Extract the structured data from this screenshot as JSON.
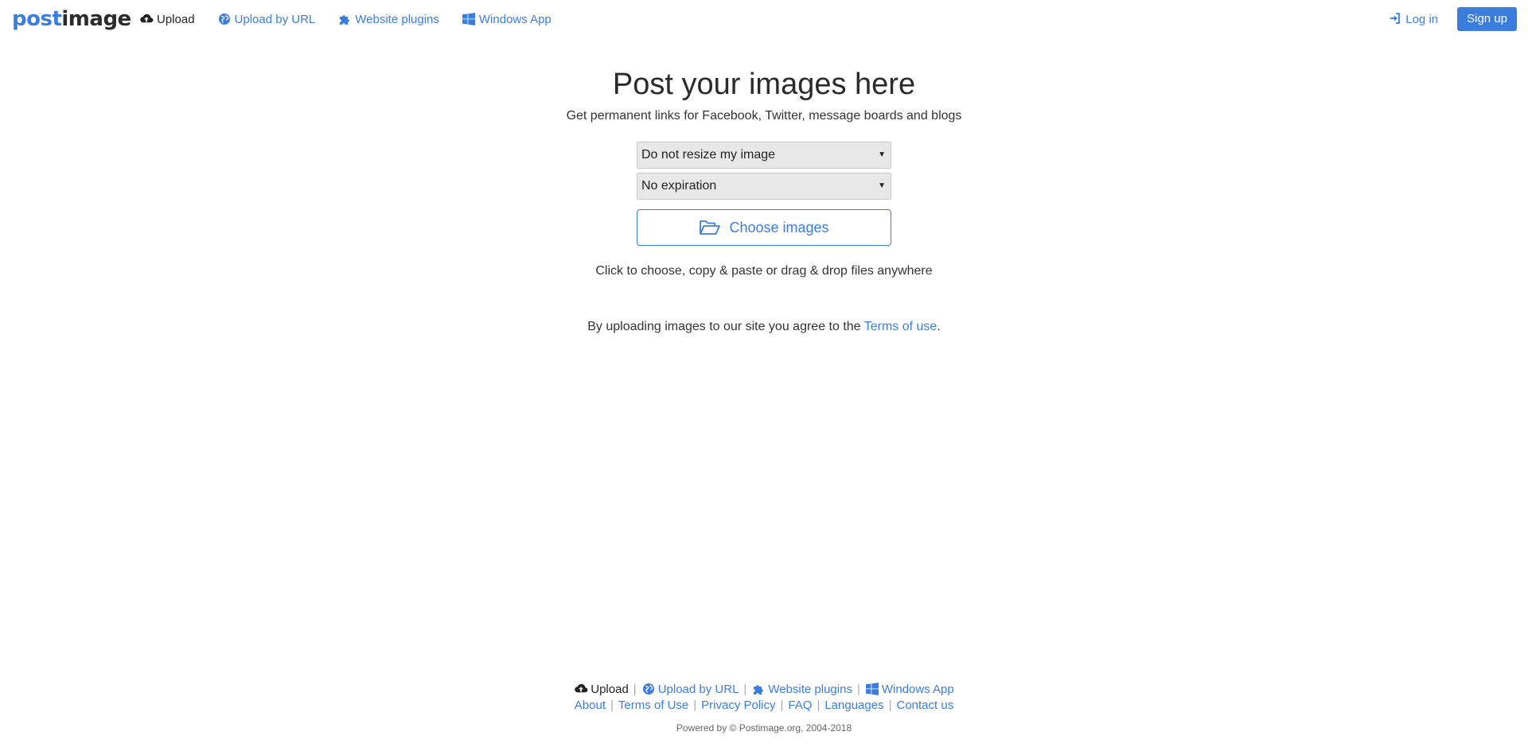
{
  "brand": {
    "logo_part1": "post",
    "logo_part2": "image",
    "accent_color": "#3b7ddd"
  },
  "nav": {
    "items": [
      {
        "label": "Upload",
        "icon": "cloud-upload-icon",
        "active": true
      },
      {
        "label": "Upload by URL",
        "icon": "globe-icon",
        "active": false
      },
      {
        "label": "Website plugins",
        "icon": "puzzle-icon",
        "active": false
      },
      {
        "label": "Windows App",
        "icon": "windows-icon",
        "active": false
      }
    ],
    "login_label": "Log in",
    "signup_label": "Sign up"
  },
  "main": {
    "title": "Post your images here",
    "subtitle": "Get permanent links for Facebook, Twitter, message boards and blogs",
    "resize_select": "Do not resize my image",
    "expiration_select": "No expiration",
    "choose_label": "Choose images",
    "hint": "Click to choose, copy & paste or drag & drop files anywhere",
    "terms_prefix": "By uploading images to our site you agree to the ",
    "terms_link": "Terms of use",
    "terms_suffix": "."
  },
  "footer": {
    "row1": [
      {
        "label": "Upload",
        "icon": "cloud-upload-icon"
      },
      {
        "label": "Upload by URL",
        "icon": "globe-icon"
      },
      {
        "label": "Website plugins",
        "icon": "puzzle-icon"
      },
      {
        "label": "Windows App",
        "icon": "windows-icon"
      }
    ],
    "row2": [
      "About",
      "Terms of Use",
      "Privacy Policy",
      "FAQ",
      "Languages",
      "Contact us"
    ],
    "separator": "|",
    "powered": "Powered by © Postimage.org, 2004-2018"
  }
}
